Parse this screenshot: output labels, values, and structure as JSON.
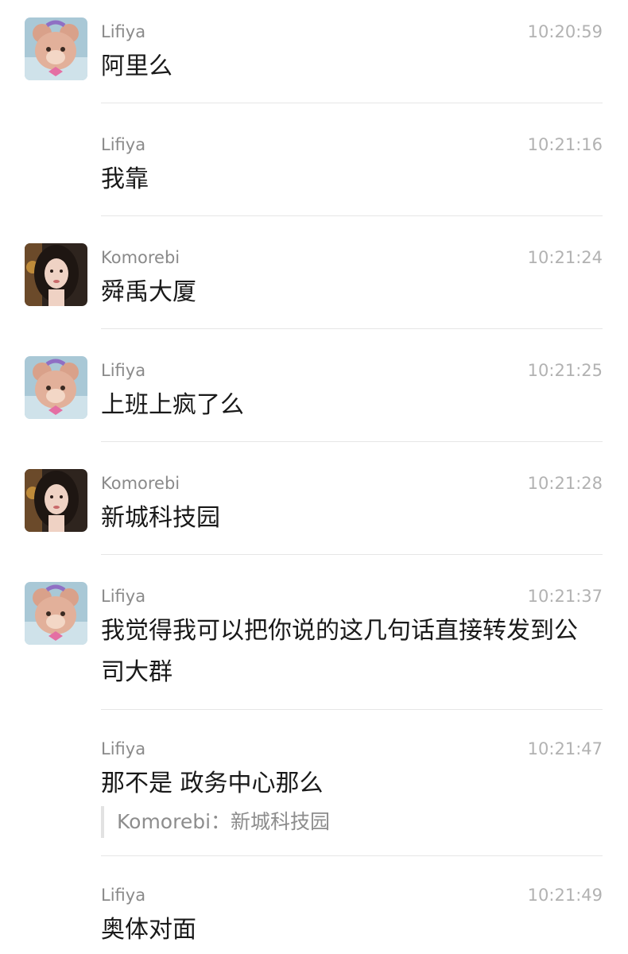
{
  "messages": [
    {
      "sender": "Lifiya",
      "time": "10:20:59",
      "text": "阿里么",
      "avatar": "lifiya-plush"
    },
    {
      "sender": "Lifiya",
      "time": "10:21:16",
      "text": "我靠"
    },
    {
      "sender": "Komorebi",
      "time": "10:21:24",
      "text": "舜禹大厦",
      "avatar": "komorebi-portrait"
    },
    {
      "sender": "Lifiya",
      "time": "10:21:25",
      "text": "上班上疯了么",
      "avatar": "lifiya-plush"
    },
    {
      "sender": "Komorebi",
      "time": "10:21:28",
      "text": "新城科技园",
      "avatar": "komorebi-portrait"
    },
    {
      "sender": "Lifiya",
      "time": "10:21:37",
      "text": "我觉得我可以把你说的这几句话直接转发到公司大群",
      "avatar": "lifiya-plush"
    },
    {
      "sender": "Lifiya",
      "time": "10:21:47",
      "text": "那不是 政务中心那么",
      "quote": "Komorebi：新城科技园"
    },
    {
      "sender": "Lifiya",
      "time": "10:21:49",
      "text": "奥体对面"
    }
  ]
}
